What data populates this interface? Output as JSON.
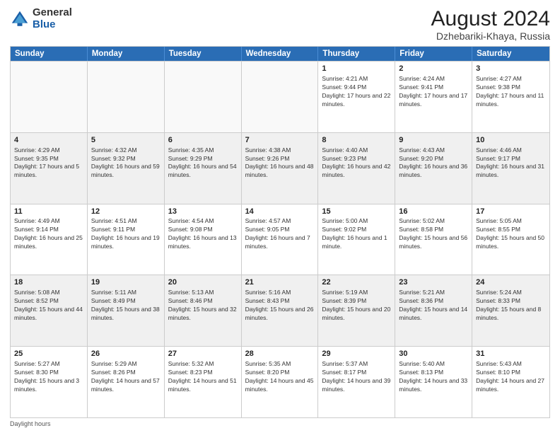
{
  "logo": {
    "general": "General",
    "blue": "Blue"
  },
  "title": "August 2024",
  "subtitle": "Dzhebariki-Khaya, Russia",
  "days": [
    "Sunday",
    "Monday",
    "Tuesday",
    "Wednesday",
    "Thursday",
    "Friday",
    "Saturday"
  ],
  "weeks": [
    [
      {
        "day": "",
        "empty": true
      },
      {
        "day": "",
        "empty": true
      },
      {
        "day": "",
        "empty": true
      },
      {
        "day": "",
        "empty": true
      },
      {
        "day": "1",
        "sunrise": "4:21 AM",
        "sunset": "9:44 PM",
        "daylight": "17 hours and 22 minutes."
      },
      {
        "day": "2",
        "sunrise": "4:24 AM",
        "sunset": "9:41 PM",
        "daylight": "17 hours and 17 minutes."
      },
      {
        "day": "3",
        "sunrise": "4:27 AM",
        "sunset": "9:38 PM",
        "daylight": "17 hours and 11 minutes."
      }
    ],
    [
      {
        "day": "4",
        "sunrise": "4:29 AM",
        "sunset": "9:35 PM",
        "daylight": "17 hours and 5 minutes.",
        "shaded": true
      },
      {
        "day": "5",
        "sunrise": "4:32 AM",
        "sunset": "9:32 PM",
        "daylight": "16 hours and 59 minutes.",
        "shaded": true
      },
      {
        "day": "6",
        "sunrise": "4:35 AM",
        "sunset": "9:29 PM",
        "daylight": "16 hours and 54 minutes.",
        "shaded": true
      },
      {
        "day": "7",
        "sunrise": "4:38 AM",
        "sunset": "9:26 PM",
        "daylight": "16 hours and 48 minutes.",
        "shaded": true
      },
      {
        "day": "8",
        "sunrise": "4:40 AM",
        "sunset": "9:23 PM",
        "daylight": "16 hours and 42 minutes.",
        "shaded": true
      },
      {
        "day": "9",
        "sunrise": "4:43 AM",
        "sunset": "9:20 PM",
        "daylight": "16 hours and 36 minutes.",
        "shaded": true
      },
      {
        "day": "10",
        "sunrise": "4:46 AM",
        "sunset": "9:17 PM",
        "daylight": "16 hours and 31 minutes.",
        "shaded": true
      }
    ],
    [
      {
        "day": "11",
        "sunrise": "4:49 AM",
        "sunset": "9:14 PM",
        "daylight": "16 hours and 25 minutes."
      },
      {
        "day": "12",
        "sunrise": "4:51 AM",
        "sunset": "9:11 PM",
        "daylight": "16 hours and 19 minutes."
      },
      {
        "day": "13",
        "sunrise": "4:54 AM",
        "sunset": "9:08 PM",
        "daylight": "16 hours and 13 minutes."
      },
      {
        "day": "14",
        "sunrise": "4:57 AM",
        "sunset": "9:05 PM",
        "daylight": "16 hours and 7 minutes."
      },
      {
        "day": "15",
        "sunrise": "5:00 AM",
        "sunset": "9:02 PM",
        "daylight": "16 hours and 1 minute."
      },
      {
        "day": "16",
        "sunrise": "5:02 AM",
        "sunset": "8:58 PM",
        "daylight": "15 hours and 56 minutes."
      },
      {
        "day": "17",
        "sunrise": "5:05 AM",
        "sunset": "8:55 PM",
        "daylight": "15 hours and 50 minutes."
      }
    ],
    [
      {
        "day": "18",
        "sunrise": "5:08 AM",
        "sunset": "8:52 PM",
        "daylight": "15 hours and 44 minutes.",
        "shaded": true
      },
      {
        "day": "19",
        "sunrise": "5:11 AM",
        "sunset": "8:49 PM",
        "daylight": "15 hours and 38 minutes.",
        "shaded": true
      },
      {
        "day": "20",
        "sunrise": "5:13 AM",
        "sunset": "8:46 PM",
        "daylight": "15 hours and 32 minutes.",
        "shaded": true
      },
      {
        "day": "21",
        "sunrise": "5:16 AM",
        "sunset": "8:43 PM",
        "daylight": "15 hours and 26 minutes.",
        "shaded": true
      },
      {
        "day": "22",
        "sunrise": "5:19 AM",
        "sunset": "8:39 PM",
        "daylight": "15 hours and 20 minutes.",
        "shaded": true
      },
      {
        "day": "23",
        "sunrise": "5:21 AM",
        "sunset": "8:36 PM",
        "daylight": "15 hours and 14 minutes.",
        "shaded": true
      },
      {
        "day": "24",
        "sunrise": "5:24 AM",
        "sunset": "8:33 PM",
        "daylight": "15 hours and 8 minutes.",
        "shaded": true
      }
    ],
    [
      {
        "day": "25",
        "sunrise": "5:27 AM",
        "sunset": "8:30 PM",
        "daylight": "15 hours and 3 minutes."
      },
      {
        "day": "26",
        "sunrise": "5:29 AM",
        "sunset": "8:26 PM",
        "daylight": "14 hours and 57 minutes."
      },
      {
        "day": "27",
        "sunrise": "5:32 AM",
        "sunset": "8:23 PM",
        "daylight": "14 hours and 51 minutes."
      },
      {
        "day": "28",
        "sunrise": "5:35 AM",
        "sunset": "8:20 PM",
        "daylight": "14 hours and 45 minutes."
      },
      {
        "day": "29",
        "sunrise": "5:37 AM",
        "sunset": "8:17 PM",
        "daylight": "14 hours and 39 minutes."
      },
      {
        "day": "30",
        "sunrise": "5:40 AM",
        "sunset": "8:13 PM",
        "daylight": "14 hours and 33 minutes."
      },
      {
        "day": "31",
        "sunrise": "5:43 AM",
        "sunset": "8:10 PM",
        "daylight": "14 hours and 27 minutes."
      }
    ]
  ],
  "footer": "Daylight hours"
}
